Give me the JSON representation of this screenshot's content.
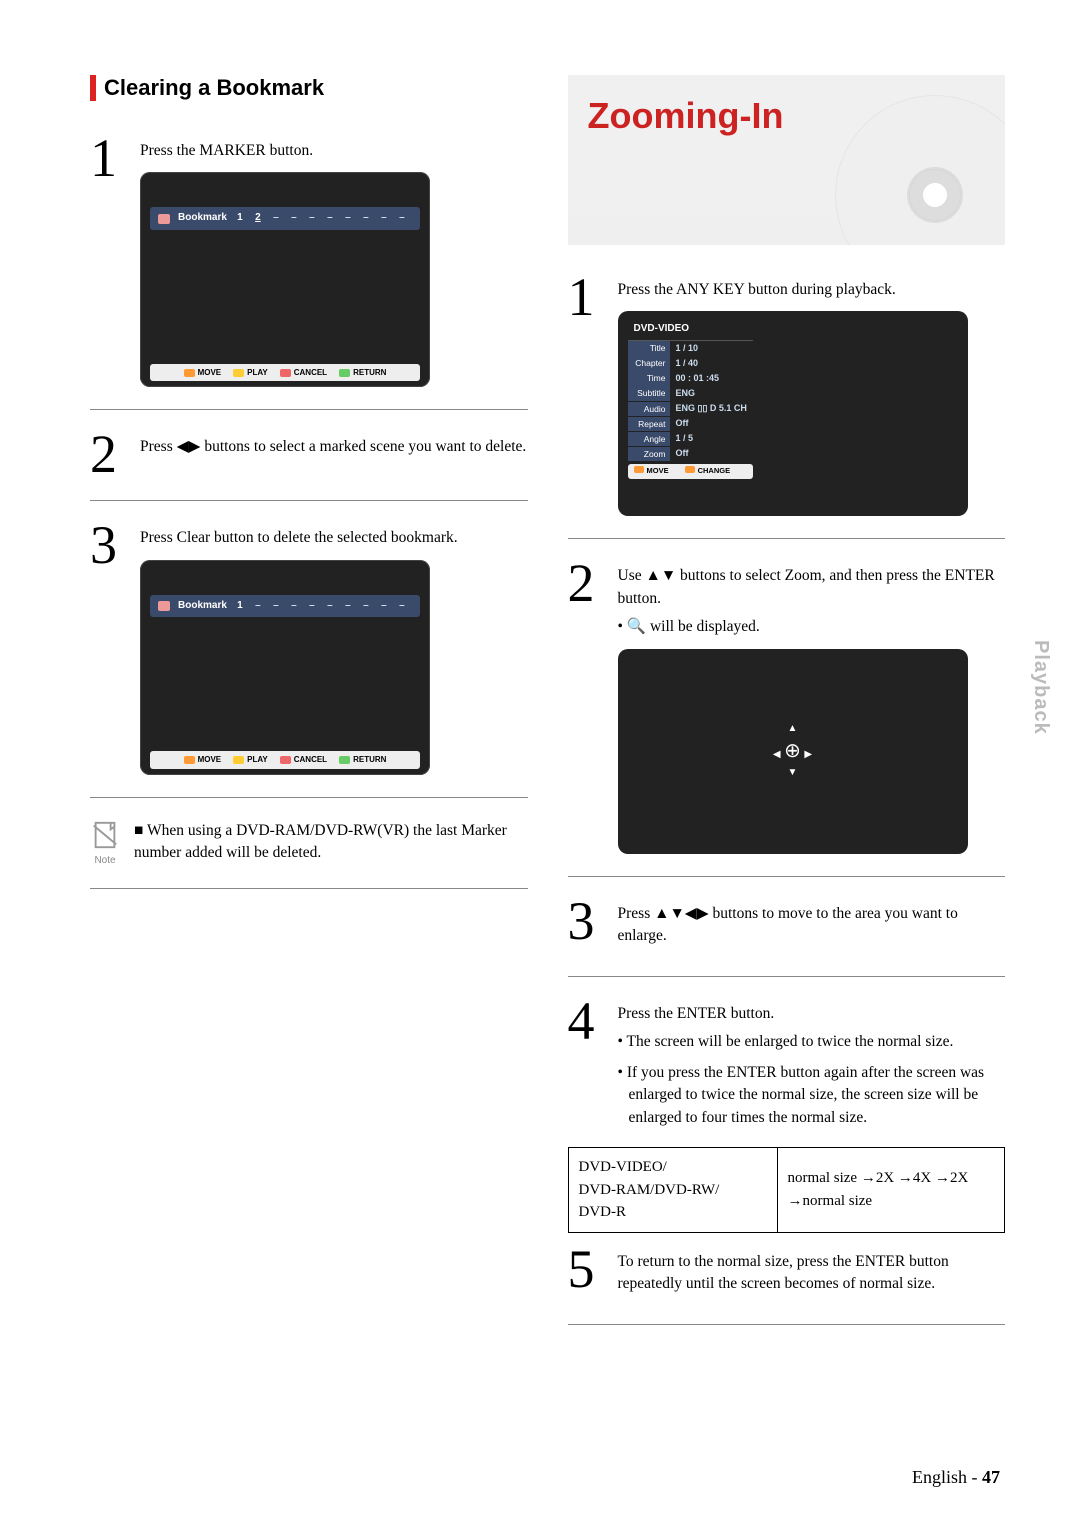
{
  "leftSection": {
    "title": "Clearing a Bookmark",
    "step1": {
      "text": "Press the MARKER button.",
      "screen": {
        "bookmarkLabel": "Bookmark",
        "slots": [
          "1",
          "2",
          "–",
          "–",
          "–",
          "–",
          "–",
          "–",
          "–",
          "–"
        ],
        "footer": {
          "move": "MOVE",
          "play": "PLAY",
          "cancel": "CANCEL",
          "return": "RETURN"
        }
      }
    },
    "step2": {
      "text": "Press ◀▶ buttons to select a marked scene you want to delete."
    },
    "step3": {
      "text": "Press Clear button to delete the selected bookmark.",
      "screen": {
        "bookmarkLabel": "Bookmark",
        "slots": [
          "1",
          "–",
          "–",
          "–",
          "–",
          "–",
          "–",
          "–",
          "–",
          "–"
        ],
        "footer": {
          "move": "MOVE",
          "play": "PLAY",
          "cancel": "CANCEL",
          "return": "RETURN"
        }
      }
    },
    "note": {
      "label": "Note",
      "text": "When using a DVD-RAM/DVD-RW(VR) the last Marker number added will be deleted."
    }
  },
  "rightSection": {
    "title": "Zooming-In",
    "step1": {
      "text": "Press the ANY KEY button during playback.",
      "panel": {
        "header": "DVD-VIDEO",
        "rows": [
          {
            "label": "Title",
            "value": "1 / 10"
          },
          {
            "label": "Chapter",
            "value": "1 / 40"
          },
          {
            "label": "Time",
            "value": "00 : 01 :45"
          },
          {
            "label": "Subtitle",
            "value": "ENG"
          },
          {
            "label": "Audio",
            "value": "ENG ▯▯ D 5.1 CH"
          },
          {
            "label": "Repeat",
            "value": "Off"
          },
          {
            "label": "Angle",
            "value": "1 / 5"
          },
          {
            "label": "Zoom",
            "value": "Off"
          }
        ],
        "footer": {
          "move": "MOVE",
          "change": "CHANGE"
        }
      }
    },
    "step2": {
      "line1": "Use ▲▼ buttons to select Zoom, and then press the ENTER button.",
      "bullet1": "🔍 will be displayed."
    },
    "step3": {
      "text": "Press ▲▼◀▶ buttons to move to the area you want to enlarge."
    },
    "step4": {
      "line1": "Press the ENTER button.",
      "bullet1": "The screen will be enlarged to twice the normal size.",
      "bullet2": "If you press the ENTER button again after the screen was enlarged to twice the normal size, the screen size will be enlarged to four times the normal size."
    },
    "table": {
      "col1": "DVD-VIDEO/\nDVD-RAM/DVD-RW/\nDVD-R",
      "col2": "normal size →2X →4X →2X →normal size"
    },
    "step5": {
      "text": "To return to the normal size, press the ENTER button repeatedly until the screen becomes of normal size."
    }
  },
  "sideTab": "Playback",
  "pageLabel": "English -",
  "pageNumber": "47"
}
